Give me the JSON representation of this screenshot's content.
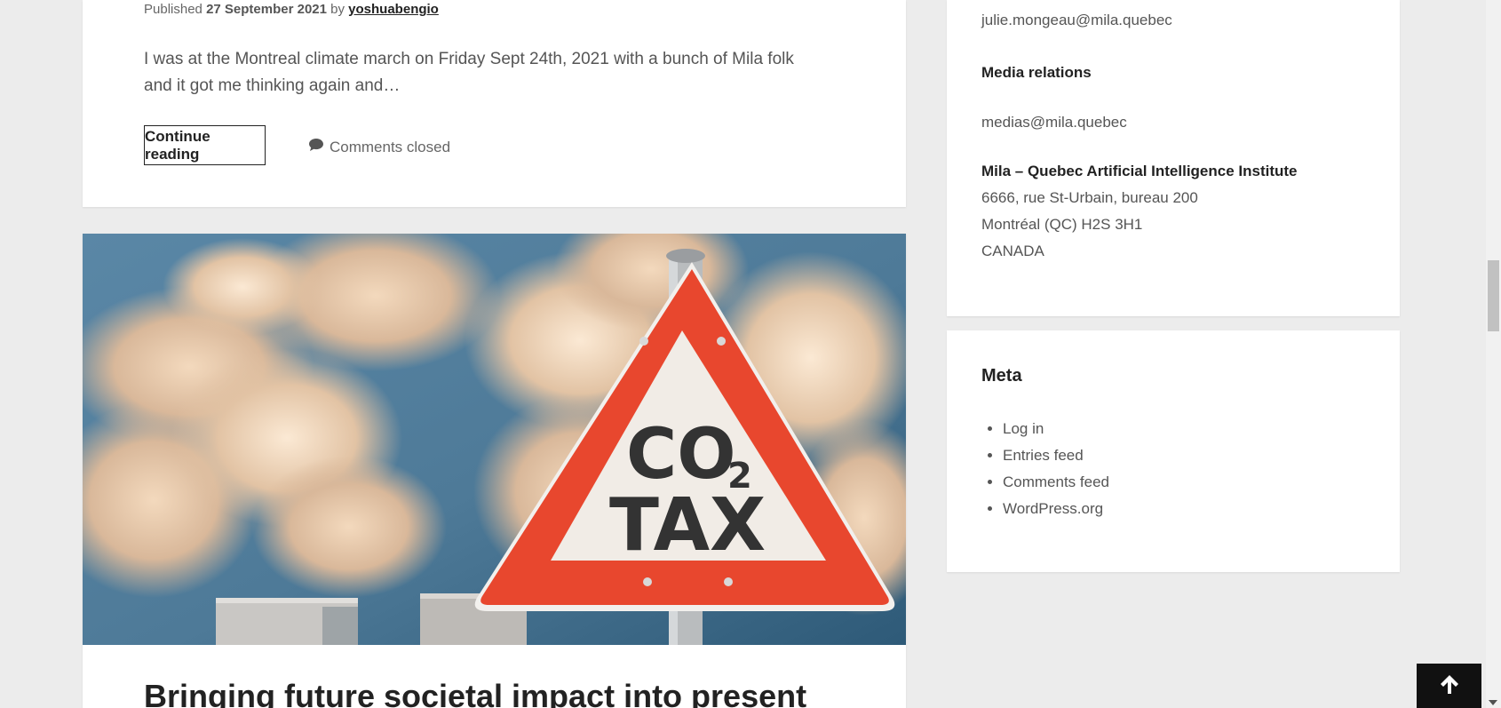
{
  "post1": {
    "meta_published": "Published",
    "meta_date": "27 September 2021",
    "meta_by": "by",
    "meta_author": "yoshuabengio",
    "excerpt": "I was at the Montreal climate march on Friday Sept 24th, 2021 with a bunch of Mila folk and it got me thinking again and…",
    "continue_label": "Continue reading",
    "comments_label": "Comments closed"
  },
  "post2": {
    "image_alt": "CO2 TAX road sign in front of industrial smoke",
    "sign_line1": "CO",
    "sign_sub": "2",
    "sign_line2": "TAX",
    "title": "Bringing future societal impact into present"
  },
  "sidebar": {
    "contact_email": "julie.mongeau@mila.quebec",
    "media_heading": "Media relations",
    "media_email": "medias@mila.quebec",
    "org_name": "Mila – Quebec Artificial Intelligence Institute",
    "address_line1": "6666, rue St-Urbain, bureau 200",
    "address_line2": "Montréal (QC) H2S 3H1",
    "address_line3": "CANADA",
    "meta_title": "Meta",
    "meta_links": [
      "Log in",
      "Entries feed",
      "Comments feed",
      "WordPress.org"
    ]
  },
  "icons": {
    "comment": "speech-bubble-icon",
    "back_to_top": "arrow-up-icon"
  },
  "colors": {
    "background": "#ececec",
    "sign_red": "#e8472e",
    "back_to_top_bg": "#111111"
  }
}
